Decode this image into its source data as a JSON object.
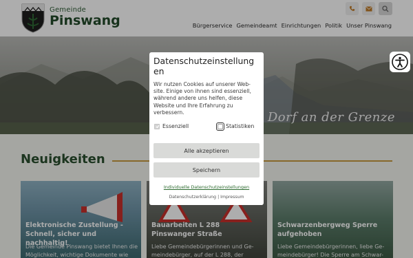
{
  "brand": {
    "prefix": "Gemeinde",
    "name": "Pinswang"
  },
  "top_icons": [
    "phone-icon",
    "mail-icon",
    "search-icon"
  ],
  "nav": [
    "Bürgerservice",
    "Gemeindeamt",
    "Einrichtungen",
    "Politik",
    "Unser Pinswang"
  ],
  "hero": {
    "slogan": "Dorf an der Grenze"
  },
  "section": {
    "title": "Neuigkeiten"
  },
  "cards": [
    {
      "title": "Elektronische Zustellung - Schnell, sicher und nachhaltig!",
      "text": "Die Gemeinde Pinswang bietet Ihnen die Möglichkeit, wichtige Dokumente wie"
    },
    {
      "title": "Bauarbeiten L 288 Pinswanger Straße",
      "text": "Liebe Gemeindebürgerinnen und Ge-meindebürger, auf der L 288, der"
    },
    {
      "title": "Schwarzenbergweg Sperre aufgehoben",
      "text": "Liebe Gemeindebürgerinnen, liebe Ge-meindebürger! Die Sperre am Schwar-"
    }
  ],
  "cookie_modal": {
    "title": "Datenschutzeinstellung en",
    "text": "Wir nutzen Cookies auf unserer Web-site. Einige von ihnen sind essenziell, während andere uns helfen, diese Website und Ihre Erfahrung zu verbessern.",
    "essential_label": "Essenziell",
    "essential_checked": true,
    "statistics_label": "Statistiken",
    "statistics_checked": false,
    "accept_all": "Alle akzeptieren",
    "save": "Speichern",
    "individual_link": "Individuelle Datenschutzeinstellungen",
    "privacy_link": "Datenschutzerklärung",
    "separator": "|",
    "imprint_link": "Impressum"
  }
}
